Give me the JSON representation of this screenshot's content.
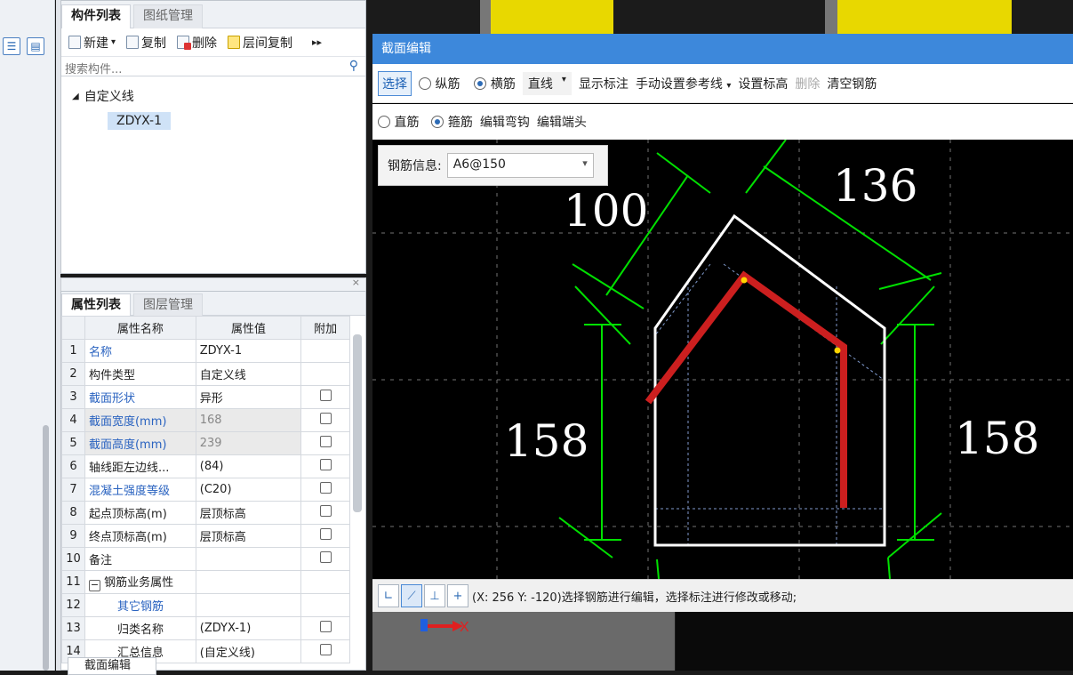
{
  "comp_panel": {
    "tabs": [
      "构件列表",
      "图纸管理"
    ],
    "toolbar": {
      "new": "新建",
      "copy": "复制",
      "delete": "删除",
      "floor_copy": "层间复制"
    },
    "search_placeholder": "搜索构件...",
    "tree": {
      "root": "自定义线",
      "leaf": "ZDYX-1"
    }
  },
  "props_panel": {
    "tabs": [
      "属性列表",
      "图层管理"
    ],
    "headers": [
      "属性名称",
      "属性值",
      "附加"
    ],
    "rows": [
      {
        "n": "1",
        "name": "名称",
        "value": "ZDYX-1"
      },
      {
        "n": "2",
        "name": "构件类型",
        "value": "自定义线"
      },
      {
        "n": "3",
        "name": "截面形状",
        "value": "异形"
      },
      {
        "n": "4",
        "name": "截面宽度(mm)",
        "value": "168"
      },
      {
        "n": "5",
        "name": "截面高度(mm)",
        "value": "239"
      },
      {
        "n": "6",
        "name": "轴线距左边线...",
        "value": "(84)"
      },
      {
        "n": "7",
        "name": "混凝土强度等级",
        "value": "(C20)"
      },
      {
        "n": "8",
        "name": "起点顶标高(m)",
        "value": "层顶标高"
      },
      {
        "n": "9",
        "name": "终点顶标高(m)",
        "value": "层顶标高"
      },
      {
        "n": "10",
        "name": "备注",
        "value": ""
      },
      {
        "n": "11",
        "name": "钢筋业务属性",
        "value": ""
      },
      {
        "n": "12",
        "name": "其它钢筋",
        "value": ""
      },
      {
        "n": "13",
        "name": "归类名称",
        "value": "(ZDYX-1)"
      },
      {
        "n": "14",
        "name": "汇总信息",
        "value": "(自定义线)"
      }
    ],
    "bottom_tab": "截面编辑"
  },
  "dialog": {
    "title": "截面编辑",
    "toolbar1": {
      "select": "选择",
      "longitudinal": "纵筋",
      "transverse": "横筋",
      "line_type": "直线",
      "show_dim": "显示标注",
      "set_ref": "手动设置参考线",
      "set_elev": "设置标高",
      "delete": "删除",
      "clear": "清空钢筋"
    },
    "toolbar2": {
      "straight": "直筋",
      "stirrup": "箍筋",
      "edit_hook": "编辑弯钩",
      "edit_end": "编辑端头"
    },
    "rebar_info_label": "钢筋信息:",
    "rebar_info_value": "A6@150",
    "dims": {
      "top_left": "100",
      "top_right": "136",
      "left": "158",
      "right": "158"
    },
    "status": "(X: 256 Y: -120)选择钢筋进行编辑，选择标注进行修改或移动;"
  },
  "axis_x_label": "X",
  "colors": {
    "accent": "#3d88db",
    "rebar": "#cc1f1f",
    "dimension": "#00e000",
    "outline": "#ffffff"
  }
}
